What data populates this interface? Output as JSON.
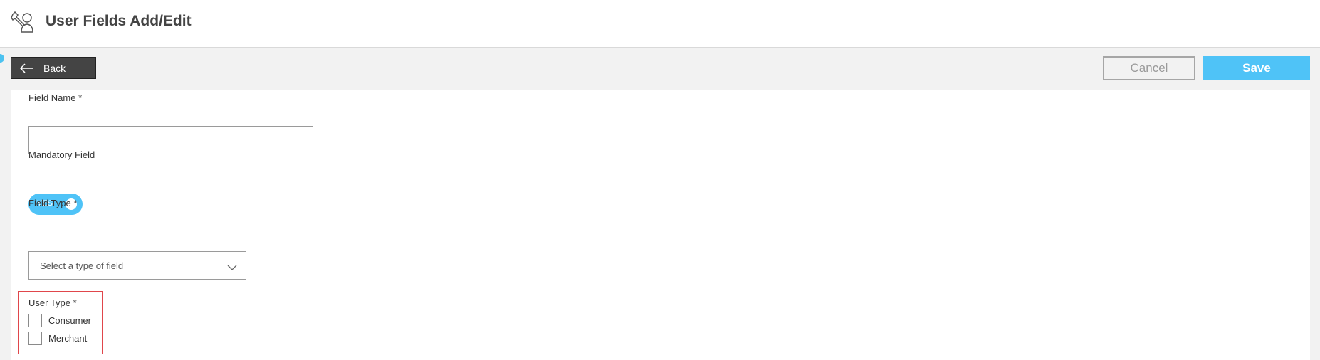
{
  "header": {
    "title": "User Fields Add/Edit",
    "icon": "wrench-person-icon"
  },
  "toolbar": {
    "back_label": "Back",
    "cancel_label": "Cancel",
    "save_label": "Save"
  },
  "form": {
    "field_name": {
      "label": "Field Name *",
      "value": ""
    },
    "mandatory": {
      "label": "Mandatory Field",
      "toggle_text": "YES",
      "enabled": true
    },
    "field_type": {
      "label": "Field Type *",
      "placeholder": "Select a type of field"
    },
    "user_type": {
      "label": "User Type *",
      "options": [
        "Consumer",
        "Merchant"
      ]
    }
  },
  "colors": {
    "accent": "#4fc3f7",
    "back_button": "#444444",
    "error_border": "#e0464b"
  }
}
